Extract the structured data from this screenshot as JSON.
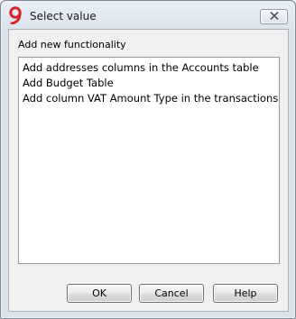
{
  "window": {
    "title": "Select value",
    "app_icon": "banana-9-icon",
    "close_icon": "close-icon"
  },
  "dialog": {
    "prompt": "Add new functionality",
    "items": [
      {
        "label": "Add addresses columns in the Accounts table"
      },
      {
        "label": "Add Budget Table"
      },
      {
        "label": "Add column VAT Amount Type in the transactions"
      }
    ]
  },
  "buttons": {
    "ok_label": "OK",
    "cancel_label": "Cancel",
    "help_label": "Help"
  },
  "colors": {
    "app_icon_red": "#d6242a",
    "titlebar": "#dce3eb",
    "close_x": "#4a5561"
  }
}
